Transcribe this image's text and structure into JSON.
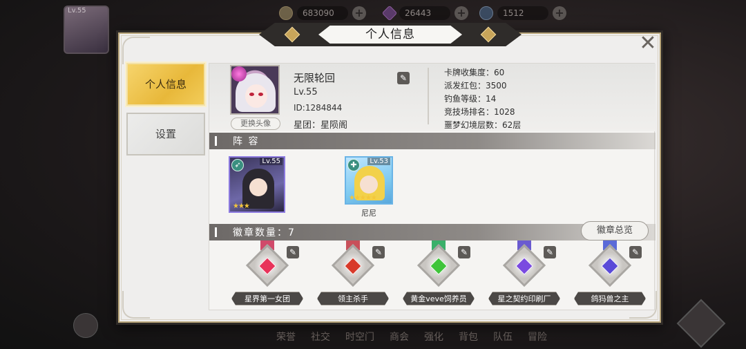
{
  "hud": {
    "player_level": "Lv.55",
    "gold": "683090",
    "gems": "26443",
    "stamina": "1512",
    "bottom_nav": [
      "荣誉",
      "社交",
      "时空门",
      "商会",
      "强化",
      "背包",
      "队伍",
      "冒险"
    ]
  },
  "modal": {
    "title": "个人信息",
    "close_label": "✕",
    "tabs": [
      {
        "label": "个人信息",
        "active": true
      },
      {
        "label": "设置",
        "active": false
      }
    ]
  },
  "profile": {
    "name": "无限轮回",
    "level": "Lv.55",
    "id": "ID:1284844",
    "guild": "星团：星陨阁",
    "change_avatar_label": "更换头像",
    "stats": [
      "卡牌收集度：60",
      "派发红包：3500",
      "钓鱼等级：14",
      "竞技场排名：1028",
      "噩梦幻境层数：62层"
    ]
  },
  "lineup": {
    "section_label": "阵 容",
    "heroes": [
      {
        "level": "Lv.55",
        "stars": "★★★",
        "name": ""
      },
      {
        "level": "Lv.53",
        "stars": "★★★★★",
        "name": "尼尼"
      }
    ]
  },
  "badges": {
    "section_label": "徽章数量：7",
    "overview_label": "徽章总览",
    "items": [
      {
        "name": "星界第一女团",
        "gem_color": "#e8335a",
        "ribbon_color": "#d04a6a"
      },
      {
        "name": "领主杀手",
        "gem_color": "#d83a2a",
        "ribbon_color": "#c8505a"
      },
      {
        "name": "黄金veve饲养员",
        "gem_color": "#3fc43a",
        "ribbon_color": "#3ab06a"
      },
      {
        "name": "星之契约印刷厂",
        "gem_color": "#7a4ae0",
        "ribbon_color": "#6a5ad0"
      },
      {
        "name": "鸽犸兽之主",
        "gem_color": "#5a4ad8",
        "ribbon_color": "#5a6ad8"
      }
    ]
  }
}
